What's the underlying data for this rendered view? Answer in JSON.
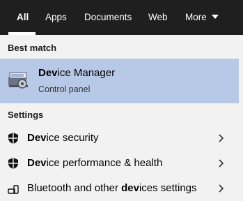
{
  "tabs": [
    {
      "label": "All",
      "active": true
    },
    {
      "label": "Apps"
    },
    {
      "label": "Documents"
    },
    {
      "label": "Web"
    },
    {
      "label": "More"
    }
  ],
  "best_match": {
    "heading": "Best match",
    "title_bold": "Dev",
    "title_rest": "ice Manager",
    "subtitle": "Control panel",
    "icon": "device-manager-icon"
  },
  "settings": {
    "heading": "Settings",
    "items": [
      {
        "pre": "",
        "bold": "Dev",
        "post": "ice security",
        "icon": "shield-icon"
      },
      {
        "pre": "",
        "bold": "Dev",
        "post": "ice performance & health",
        "icon": "shield-icon"
      },
      {
        "pre": "Bluetooth and other ",
        "bold": "dev",
        "post": "ices settings",
        "icon": "bluetooth-devices-icon"
      }
    ]
  },
  "colors": {
    "topbar": "#1f1f1f",
    "background": "#f2f2f2",
    "selected_row": "#b8c9e8"
  }
}
